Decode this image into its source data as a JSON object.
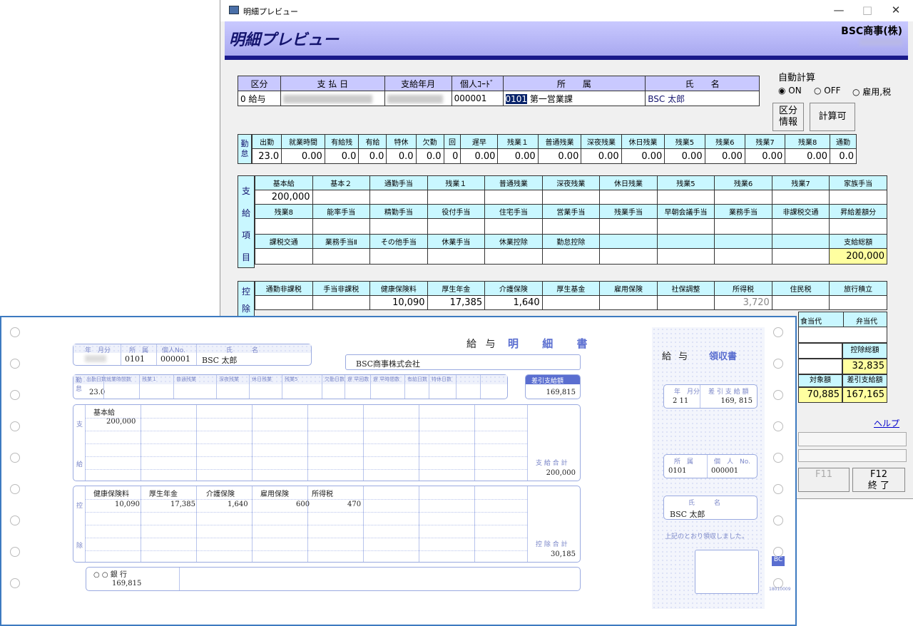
{
  "window": {
    "title": "明細プレビュー",
    "header": "明細プレビュー",
    "company": "BSC商事(株)",
    "min": "—",
    "max": "□",
    "close": "✕"
  },
  "top": {
    "headers": [
      "区分",
      "支 払 日",
      "支給年月",
      "個人ｺｰﾄﾞ",
      "所　　属",
      "氏　　名"
    ],
    "kubun": "0 給与",
    "code": "000001",
    "dept_code": "0101",
    "dept_name": "第一営業課",
    "name": "BSC 太郎"
  },
  "auto": {
    "label": "自動計算",
    "on": "ON",
    "off": "OFF",
    "tax": "雇用,税"
  },
  "buttons": {
    "kubun": "区分\n情報",
    "calc": "計算可",
    "f11": "F11",
    "f12": "F12",
    "f12sub": "終 了",
    "help": "ヘルプ"
  },
  "kintai": {
    "side": "勤怠",
    "headers": [
      "出勤",
      "就業時間",
      "有給残",
      "有給",
      "特休",
      "欠勤",
      "回",
      "遅早",
      "残業１",
      "普通残業",
      "深夜残業",
      "休日残業",
      "残業5",
      "残業6",
      "残業7",
      "残業8",
      "通勤"
    ],
    "values": [
      "23.0",
      "0.00",
      "0.0",
      "0.0",
      "0.0",
      "0.0",
      "0",
      "0.00",
      "0.00",
      "0.00",
      "0.00",
      "0.00",
      "0.00",
      "0.00",
      "0.00",
      "0.00",
      "0.0"
    ]
  },
  "shikyu": {
    "side": [
      "支",
      "給",
      "項",
      "目"
    ],
    "r1": [
      "基本給",
      "基本２",
      "通勤手当",
      "残業１",
      "普通残業",
      "深夜残業",
      "休日残業",
      "残業5",
      "残業6",
      "残業7",
      "家族手当"
    ],
    "v1": [
      "200,000",
      "",
      "",
      "",
      "",
      "",
      "",
      "",
      "",
      "",
      ""
    ],
    "r2": [
      "残業8",
      "能率手当",
      "精勤手当",
      "役付手当",
      "住宅手当",
      "営業手当",
      "残業手当",
      "早朝会議手当",
      "業務手当",
      "非課税交通",
      "昇給差額分"
    ],
    "r3": [
      "課税交通",
      "業務手当Ⅱ",
      "その他手当",
      "休業手当",
      "休業控除",
      "勤怠控除",
      "",
      "",
      "",
      "",
      "支給総額"
    ],
    "total": "200,000"
  },
  "kojo": {
    "side": [
      "控",
      "除"
    ],
    "r1": [
      "通勤非課税",
      "手当非課税",
      "健康保険料",
      "厚生年金",
      "介護保険",
      "厚生基金",
      "雇用保険",
      "社保調整",
      "所得税",
      "住民税",
      "旅行積立"
    ],
    "v1": [
      "",
      "",
      "10,090",
      "17,385",
      "1,640",
      "",
      "",
      "",
      "3,720",
      "",
      ""
    ],
    "r2b": [
      "食当代",
      "弁当代"
    ],
    "total_label": "控除総額",
    "total": "32,835",
    "taisho_label": "対象額",
    "taisho": "70,885",
    "sashi_label": "差引支給額",
    "sashi": "167,165"
  },
  "form": {
    "title1": "給 与",
    "title2": "明 細 書",
    "company": "BSC商事株式会社",
    "hdr": [
      "年　月分",
      "所　属",
      "個人No.",
      "氏　　　名"
    ],
    "dept": "0101",
    "no": "000001",
    "name": "BSC 太郎",
    "kintai_hdr": [
      "出勤日数",
      "就業時間数",
      "残業１",
      "普通残業",
      "深夜残業",
      "休日残業",
      "残業5",
      "欠勤日数",
      "遅 早回数",
      "遅 早時間数",
      "有給日数",
      "特休日数"
    ],
    "kintai_val": "23.0",
    "side_kin": [
      "勤",
      "怠"
    ],
    "sashi_label": "差引支給額",
    "sashi": "169,815",
    "shikyu_label": "基本給",
    "shikyu_val": "200,000",
    "side_shi": [
      "支",
      "給"
    ],
    "shikyu_total_label": "支 給 合 計",
    "shikyu_total": "200,000",
    "kojo_hdr": [
      "健康保険料",
      "厚生年金",
      "介護保険",
      "雇用保険",
      "所得税"
    ],
    "kojo_val": [
      "10,090",
      "17,385",
      "1,640",
      "600",
      "470"
    ],
    "side_ko": [
      "控",
      "除"
    ],
    "kojo_total_label": "控 除 合 計",
    "kojo_total": "30,185",
    "bank": "○ ○ 銀 行",
    "bank_val": "169,815",
    "r_title1": "給 与",
    "r_title2": "領収書",
    "r_hdr": [
      "年　月分",
      "差 引 支 給 額"
    ],
    "r_month": "2 11",
    "r_amount": "169, 815",
    "r_dept_hdr": [
      "所　属",
      "個　人　No."
    ],
    "r_dept": "0101",
    "r_no": "000001",
    "r_name_hdr": "氏　　　名",
    "r_name": "BSC 太郎",
    "r_note": "上記のとおり領収しました。",
    "r_mark": "BC",
    "r_code": "18010009"
  }
}
